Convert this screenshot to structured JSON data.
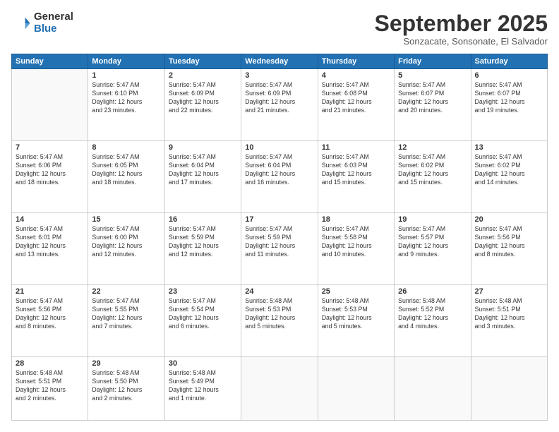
{
  "logo": {
    "general": "General",
    "blue": "Blue"
  },
  "header": {
    "month": "September 2025",
    "location": "Sonzacate, Sonsonate, El Salvador"
  },
  "weekdays": [
    "Sunday",
    "Monday",
    "Tuesday",
    "Wednesday",
    "Thursday",
    "Friday",
    "Saturday"
  ],
  "weeks": [
    [
      {
        "day": "",
        "info": ""
      },
      {
        "day": "1",
        "info": "Sunrise: 5:47 AM\nSunset: 6:10 PM\nDaylight: 12 hours\nand 23 minutes."
      },
      {
        "day": "2",
        "info": "Sunrise: 5:47 AM\nSunset: 6:09 PM\nDaylight: 12 hours\nand 22 minutes."
      },
      {
        "day": "3",
        "info": "Sunrise: 5:47 AM\nSunset: 6:09 PM\nDaylight: 12 hours\nand 21 minutes."
      },
      {
        "day": "4",
        "info": "Sunrise: 5:47 AM\nSunset: 6:08 PM\nDaylight: 12 hours\nand 21 minutes."
      },
      {
        "day": "5",
        "info": "Sunrise: 5:47 AM\nSunset: 6:07 PM\nDaylight: 12 hours\nand 20 minutes."
      },
      {
        "day": "6",
        "info": "Sunrise: 5:47 AM\nSunset: 6:07 PM\nDaylight: 12 hours\nand 19 minutes."
      }
    ],
    [
      {
        "day": "7",
        "info": "Sunrise: 5:47 AM\nSunset: 6:06 PM\nDaylight: 12 hours\nand 18 minutes."
      },
      {
        "day": "8",
        "info": "Sunrise: 5:47 AM\nSunset: 6:05 PM\nDaylight: 12 hours\nand 18 minutes."
      },
      {
        "day": "9",
        "info": "Sunrise: 5:47 AM\nSunset: 6:04 PM\nDaylight: 12 hours\nand 17 minutes."
      },
      {
        "day": "10",
        "info": "Sunrise: 5:47 AM\nSunset: 6:04 PM\nDaylight: 12 hours\nand 16 minutes."
      },
      {
        "day": "11",
        "info": "Sunrise: 5:47 AM\nSunset: 6:03 PM\nDaylight: 12 hours\nand 15 minutes."
      },
      {
        "day": "12",
        "info": "Sunrise: 5:47 AM\nSunset: 6:02 PM\nDaylight: 12 hours\nand 15 minutes."
      },
      {
        "day": "13",
        "info": "Sunrise: 5:47 AM\nSunset: 6:02 PM\nDaylight: 12 hours\nand 14 minutes."
      }
    ],
    [
      {
        "day": "14",
        "info": "Sunrise: 5:47 AM\nSunset: 6:01 PM\nDaylight: 12 hours\nand 13 minutes."
      },
      {
        "day": "15",
        "info": "Sunrise: 5:47 AM\nSunset: 6:00 PM\nDaylight: 12 hours\nand 12 minutes."
      },
      {
        "day": "16",
        "info": "Sunrise: 5:47 AM\nSunset: 5:59 PM\nDaylight: 12 hours\nand 12 minutes."
      },
      {
        "day": "17",
        "info": "Sunrise: 5:47 AM\nSunset: 5:59 PM\nDaylight: 12 hours\nand 11 minutes."
      },
      {
        "day": "18",
        "info": "Sunrise: 5:47 AM\nSunset: 5:58 PM\nDaylight: 12 hours\nand 10 minutes."
      },
      {
        "day": "19",
        "info": "Sunrise: 5:47 AM\nSunset: 5:57 PM\nDaylight: 12 hours\nand 9 minutes."
      },
      {
        "day": "20",
        "info": "Sunrise: 5:47 AM\nSunset: 5:56 PM\nDaylight: 12 hours\nand 8 minutes."
      }
    ],
    [
      {
        "day": "21",
        "info": "Sunrise: 5:47 AM\nSunset: 5:56 PM\nDaylight: 12 hours\nand 8 minutes."
      },
      {
        "day": "22",
        "info": "Sunrise: 5:47 AM\nSunset: 5:55 PM\nDaylight: 12 hours\nand 7 minutes."
      },
      {
        "day": "23",
        "info": "Sunrise: 5:47 AM\nSunset: 5:54 PM\nDaylight: 12 hours\nand 6 minutes."
      },
      {
        "day": "24",
        "info": "Sunrise: 5:48 AM\nSunset: 5:53 PM\nDaylight: 12 hours\nand 5 minutes."
      },
      {
        "day": "25",
        "info": "Sunrise: 5:48 AM\nSunset: 5:53 PM\nDaylight: 12 hours\nand 5 minutes."
      },
      {
        "day": "26",
        "info": "Sunrise: 5:48 AM\nSunset: 5:52 PM\nDaylight: 12 hours\nand 4 minutes."
      },
      {
        "day": "27",
        "info": "Sunrise: 5:48 AM\nSunset: 5:51 PM\nDaylight: 12 hours\nand 3 minutes."
      }
    ],
    [
      {
        "day": "28",
        "info": "Sunrise: 5:48 AM\nSunset: 5:51 PM\nDaylight: 12 hours\nand 2 minutes."
      },
      {
        "day": "29",
        "info": "Sunrise: 5:48 AM\nSunset: 5:50 PM\nDaylight: 12 hours\nand 2 minutes."
      },
      {
        "day": "30",
        "info": "Sunrise: 5:48 AM\nSunset: 5:49 PM\nDaylight: 12 hours\nand 1 minute."
      },
      {
        "day": "",
        "info": ""
      },
      {
        "day": "",
        "info": ""
      },
      {
        "day": "",
        "info": ""
      },
      {
        "day": "",
        "info": ""
      }
    ]
  ]
}
